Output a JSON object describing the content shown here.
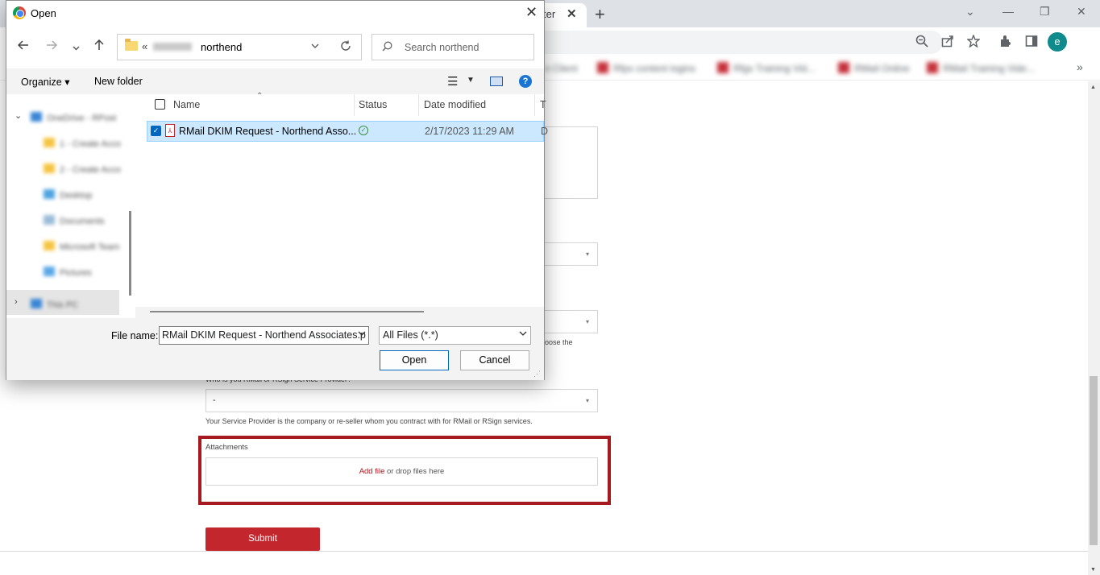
{
  "browser": {
    "tab_title": "ter",
    "tab_close": "✕",
    "new_tab": "+",
    "profile_initial": "e",
    "bookmarks_more": "»",
    "window_controls": [
      "⌄",
      "—",
      "❐",
      "✕"
    ]
  },
  "dialog": {
    "title": "Open",
    "close": "✕",
    "address": {
      "path": "northend",
      "prefix": "«"
    },
    "search_placeholder": "Search northend",
    "commands": {
      "organize": "Organize ▾",
      "new_folder": "New folder"
    },
    "columns": [
      "Name",
      "Status",
      "Date modified",
      "T"
    ],
    "files": [
      {
        "name": "RMail DKIM Request - Northend Asso...",
        "date": "2/17/2023 11:29 AM",
        "type": "D",
        "selected": true
      }
    ],
    "file_name_label": "File name:",
    "file_name_value": "RMail DKIM Request - Northend Associates.p",
    "file_type": "All Files (*.*)",
    "open_button": "Open",
    "cancel_button": "Cancel"
  },
  "page": {
    "select_placeholder": "-",
    "helper_tail": "oose the",
    "service_provider_label": "Who is you RMail or RSign Service Provider?",
    "service_provider_value": "-",
    "service_provider_helper": "Your Service Provider is the company or re-seller whom you contract with for RMail or RSign services.",
    "attachments_label": "Attachments",
    "add_file": "Add file",
    "drop_text": " or drop files here",
    "submit": "Submit"
  },
  "colors": {
    "accent_red": "#c4262e",
    "highlight_border": "#a6191f",
    "selection_blue": "#cce8ff",
    "avatar_teal": "#0f8b8d"
  }
}
